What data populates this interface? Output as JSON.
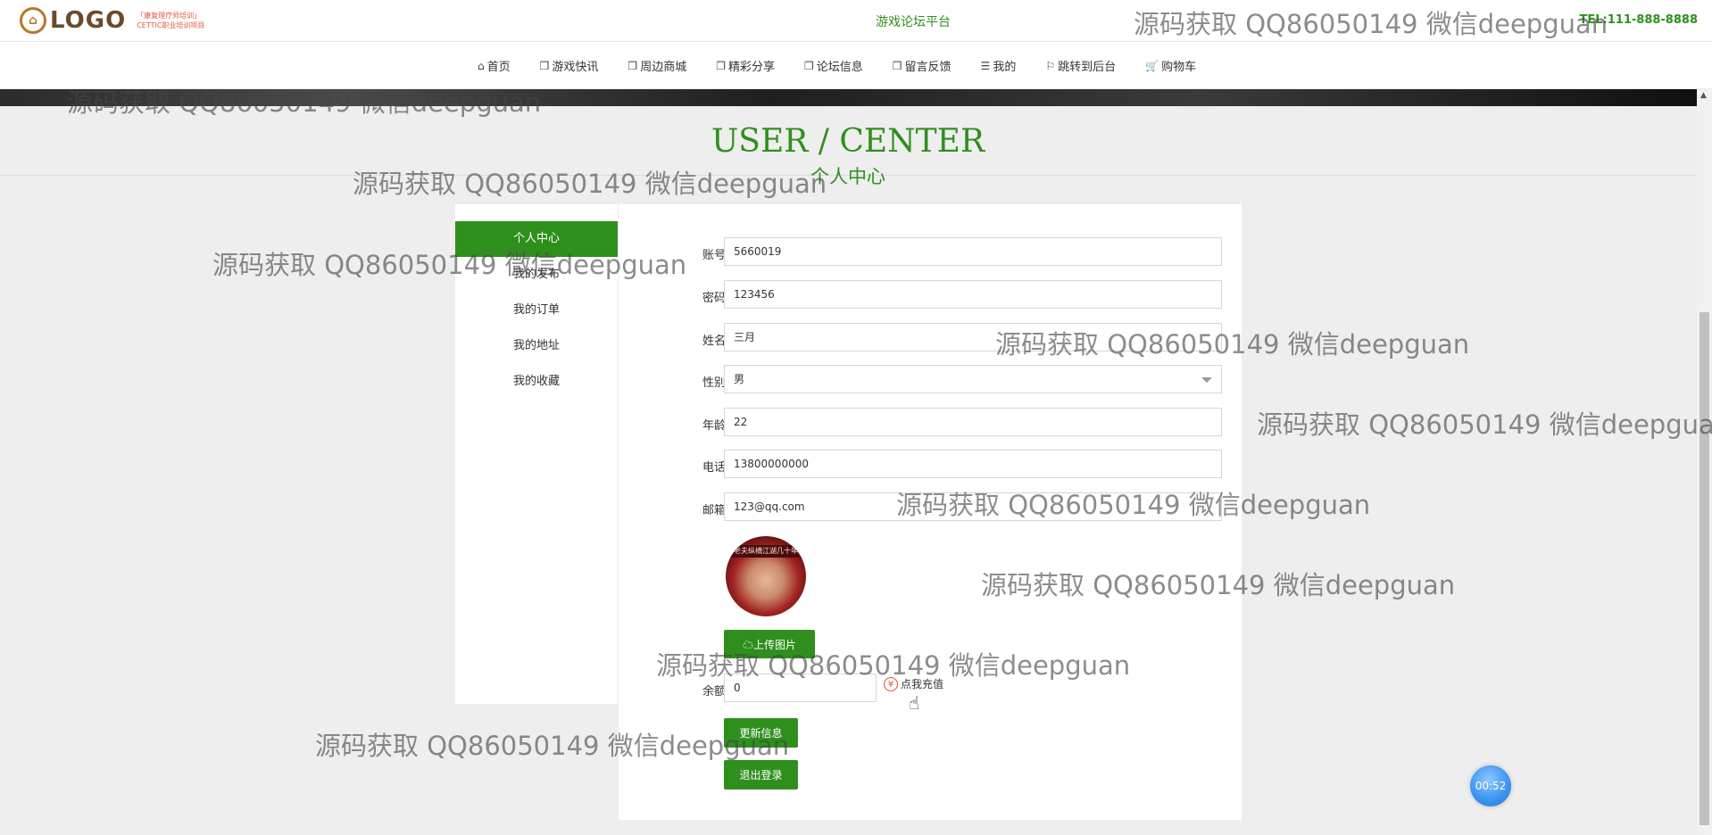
{
  "header": {
    "logo_text": "LOGO",
    "logo_sub1": "「康复理疗师培训」",
    "logo_sub2": "CETTIC职业培训项目",
    "site_title": "游戏论坛平台",
    "tel": "TEL:111-888-8888"
  },
  "nav": [
    {
      "label": "首页",
      "icon": "home-icon",
      "glyph": "⌂"
    },
    {
      "label": "游戏快讯",
      "icon": "cube-icon",
      "glyph": "❒"
    },
    {
      "label": "周边商城",
      "icon": "cube-icon",
      "glyph": "❒"
    },
    {
      "label": "精彩分享",
      "icon": "cube-icon",
      "glyph": "❒"
    },
    {
      "label": "论坛信息",
      "icon": "cube-icon",
      "glyph": "❒"
    },
    {
      "label": "留言反馈",
      "icon": "cube-icon",
      "glyph": "❒"
    },
    {
      "label": "我的",
      "icon": "list-icon",
      "glyph": "☰"
    },
    {
      "label": "跳转到后台",
      "icon": "flag-icon",
      "glyph": "⚐"
    },
    {
      "label": "购物车",
      "icon": "cart-icon",
      "glyph": "🛒"
    }
  ],
  "section": {
    "title_en": "USER / CENTER",
    "title_cn": "个人中心"
  },
  "side_menu": [
    "个人中心",
    "我的发布",
    "我的订单",
    "我的地址",
    "我的收藏"
  ],
  "form": {
    "account": {
      "label": "账号",
      "value": "5660019"
    },
    "password": {
      "label": "密码",
      "value": "123456"
    },
    "name": {
      "label": "姓名",
      "value": "三月"
    },
    "gender": {
      "label": "性别",
      "value": "男"
    },
    "age": {
      "label": "年龄",
      "value": "22"
    },
    "phone": {
      "label": "电话",
      "value": "13800000000"
    },
    "email": {
      "label": "邮箱",
      "value": "123@qq.com"
    },
    "avatar_caption": "老夫纵横江湖几十年",
    "upload_label": "上传图片",
    "balance": {
      "label": "余额",
      "value": "0"
    },
    "recharge_label": "点我充值",
    "update_label": "更新信息",
    "logout_label": "退出登录"
  },
  "timer": "00:52",
  "watermark": "源码获取 QQ86050149 微信deepguan",
  "colors": {
    "accent": "#2f8f1d",
    "timer": "#3f95f2"
  }
}
